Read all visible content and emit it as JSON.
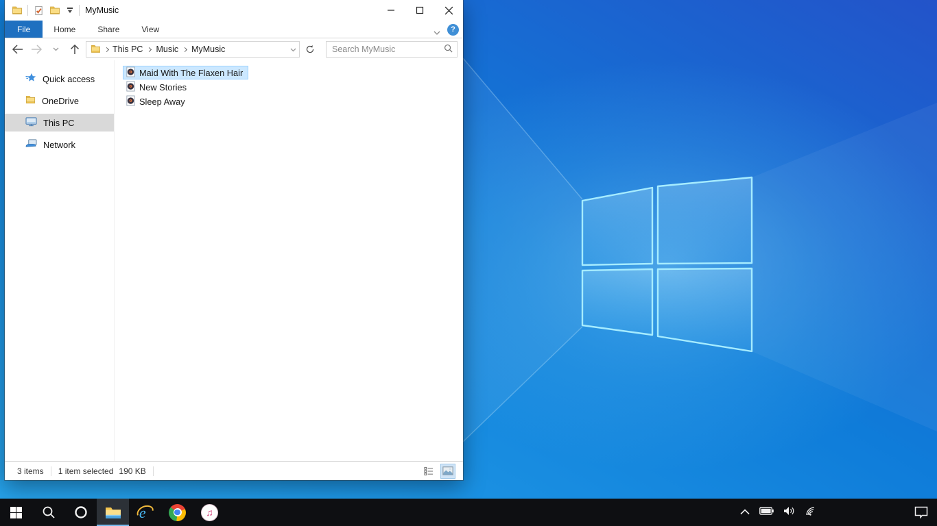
{
  "explorer": {
    "title": "MyMusic",
    "tabs": [
      {
        "label": "File",
        "active": true
      },
      {
        "label": "Home",
        "active": false
      },
      {
        "label": "Share",
        "active": false
      },
      {
        "label": "View",
        "active": false
      }
    ],
    "help_glyph": "?",
    "breadcrumb": {
      "items": [
        "This PC",
        "Music",
        "MyMusic"
      ]
    },
    "search_placeholder": "Search MyMusic",
    "sidebar_items": [
      {
        "label": "Quick access",
        "icon": "quick-access-star",
        "selected": false
      },
      {
        "label": "OneDrive",
        "icon": "onedrive-folder",
        "selected": false
      },
      {
        "label": "This PC",
        "icon": "this-pc-monitor",
        "selected": true
      },
      {
        "label": "Network",
        "icon": "network-computers",
        "selected": false
      }
    ],
    "files": [
      {
        "name": "Maid With The Flaxen Hair",
        "icon": "audio-file",
        "selected": true
      },
      {
        "name": "New Stories",
        "icon": "audio-file",
        "selected": false
      },
      {
        "name": "Sleep Away",
        "icon": "audio-file",
        "selected": false
      }
    ],
    "status": {
      "count": "3 items",
      "selection": "1 item selected",
      "size": "190 KB"
    }
  },
  "taskbar": {
    "buttons": [
      "start",
      "search",
      "cortana",
      "file-explorer",
      "internet-explorer",
      "chrome",
      "itunes"
    ],
    "active_button": "file-explorer",
    "ie_glyph": "e",
    "itunes_glyph": "♫",
    "tray_icons": [
      "hidden-icons-chevron",
      "battery",
      "volume",
      "wifi"
    ],
    "action_center": "notifications"
  },
  "colors": {
    "file_tab_active": "#1f70c0",
    "selection_bg": "#cce8ff",
    "selection_border": "#99d1ff",
    "sidebar_selected": "#d9d9d9",
    "taskbar_bg": "#0e0f12",
    "taskbar_active_underline": "#76b9ed",
    "help_badge": "#3f8fd6",
    "wallpaper_top_right": "#2353c9",
    "wallpaper_mid": "#0f7cd9",
    "wallpaper_bottom": "#27a3ea",
    "logo_edge": "#a6ecff"
  }
}
